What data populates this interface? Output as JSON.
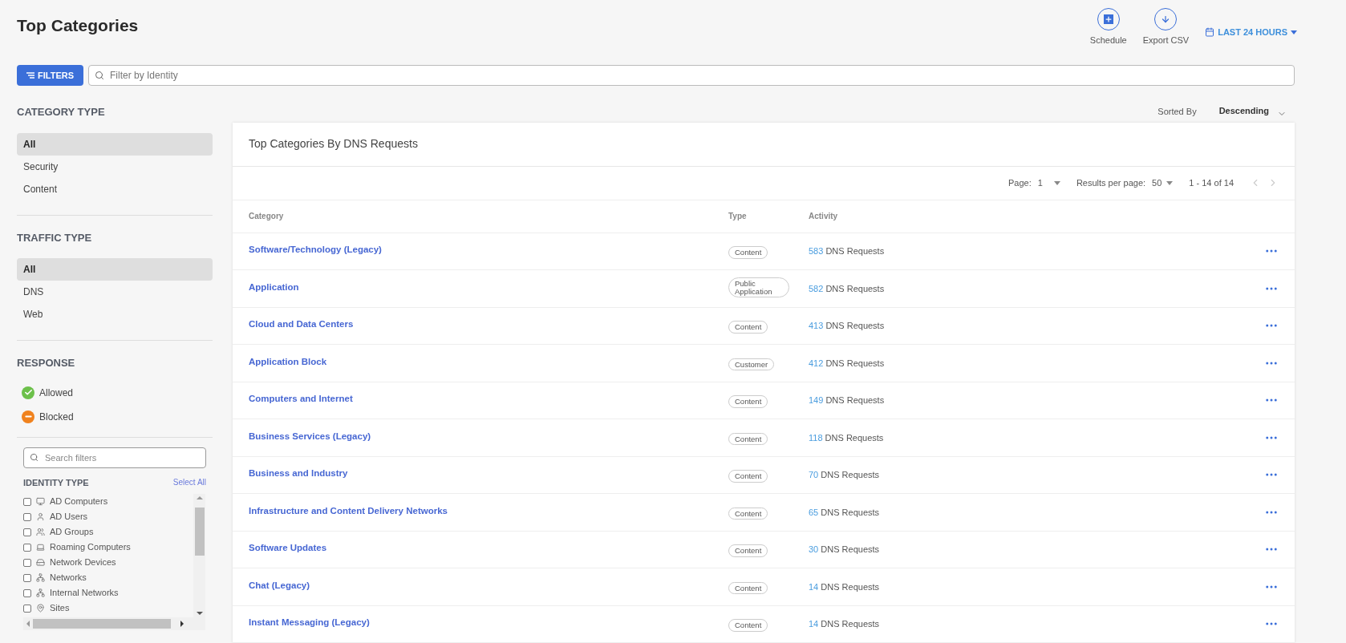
{
  "page": {
    "title": "Top Categories"
  },
  "actions": [
    {
      "kind": "schedule",
      "label": "Schedule"
    },
    {
      "kind": "export",
      "label": "Export CSV"
    }
  ],
  "time_range": {
    "label": "LAST 24 HOURS"
  },
  "filters_button": {
    "label": "FILTERS"
  },
  "identity_search": {
    "placeholder": "Filter by Identity"
  },
  "sidebar": {
    "category_type": {
      "title": "CATEGORY TYPE",
      "items": [
        {
          "label": "All",
          "selected": true
        },
        {
          "label": "Security",
          "selected": false
        },
        {
          "label": "Content",
          "selected": false
        }
      ]
    },
    "traffic_type": {
      "title": "TRAFFIC TYPE",
      "items": [
        {
          "label": "All",
          "selected": true
        },
        {
          "label": "DNS",
          "selected": false
        },
        {
          "label": "Web",
          "selected": false
        }
      ]
    },
    "response": {
      "title": "RESPONSE",
      "items": [
        {
          "kind": "allowed",
          "label": "Allowed"
        },
        {
          "kind": "blocked",
          "label": "Blocked"
        }
      ]
    },
    "search_filters": {
      "placeholder": "Search filters"
    },
    "identity_type": {
      "title": "IDENTITY TYPE",
      "select_all": "Select All",
      "items": [
        {
          "kind": "monitor",
          "label": "AD Computers",
          "checked": false
        },
        {
          "kind": "user",
          "label": "AD Users",
          "checked": false
        },
        {
          "kind": "group",
          "label": "AD Groups",
          "checked": false
        },
        {
          "kind": "laptop",
          "label": "Roaming Computers",
          "checked": false
        },
        {
          "kind": "device",
          "label": "Network Devices",
          "checked": false
        },
        {
          "kind": "network",
          "label": "Networks",
          "checked": false
        },
        {
          "kind": "network",
          "label": "Internal Networks",
          "checked": false
        },
        {
          "kind": "pin",
          "label": "Sites",
          "checked": false
        }
      ]
    }
  },
  "sort": {
    "label": "Sorted By",
    "value": "Descending"
  },
  "table": {
    "title": "Top Categories By DNS Requests",
    "pagination": {
      "page_label": "Page:",
      "page": "1",
      "per_page_label": "Results per page:",
      "per_page": "50",
      "range": "1 - 14 of 14"
    },
    "columns": [
      "Category",
      "Type",
      "Activity"
    ],
    "rows": [
      {
        "category": "Software/Technology (Legacy)",
        "type": "Content",
        "count": "583",
        "unit": "DNS Requests"
      },
      {
        "category": "Application",
        "type": "Public Application",
        "count": "582",
        "unit": "DNS Requests"
      },
      {
        "category": "Cloud and Data Centers",
        "type": "Content",
        "count": "413",
        "unit": "DNS Requests"
      },
      {
        "category": "Application Block",
        "type": "Customer",
        "count": "412",
        "unit": "DNS Requests"
      },
      {
        "category": "Computers and Internet",
        "type": "Content",
        "count": "149",
        "unit": "DNS Requests"
      },
      {
        "category": "Business Services (Legacy)",
        "type": "Content",
        "count": "118",
        "unit": "DNS Requests"
      },
      {
        "category": "Business and Industry",
        "type": "Content",
        "count": "70",
        "unit": "DNS Requests"
      },
      {
        "category": "Infrastructure and Content Delivery Networks",
        "type": "Content",
        "count": "65",
        "unit": "DNS Requests"
      },
      {
        "category": "Software Updates",
        "type": "Content",
        "count": "30",
        "unit": "DNS Requests"
      },
      {
        "category": "Chat (Legacy)",
        "type": "Content",
        "count": "14",
        "unit": "DNS Requests"
      },
      {
        "category": "Instant Messaging (Legacy)",
        "type": "Content",
        "count": "14",
        "unit": "DNS Requests"
      }
    ]
  }
}
